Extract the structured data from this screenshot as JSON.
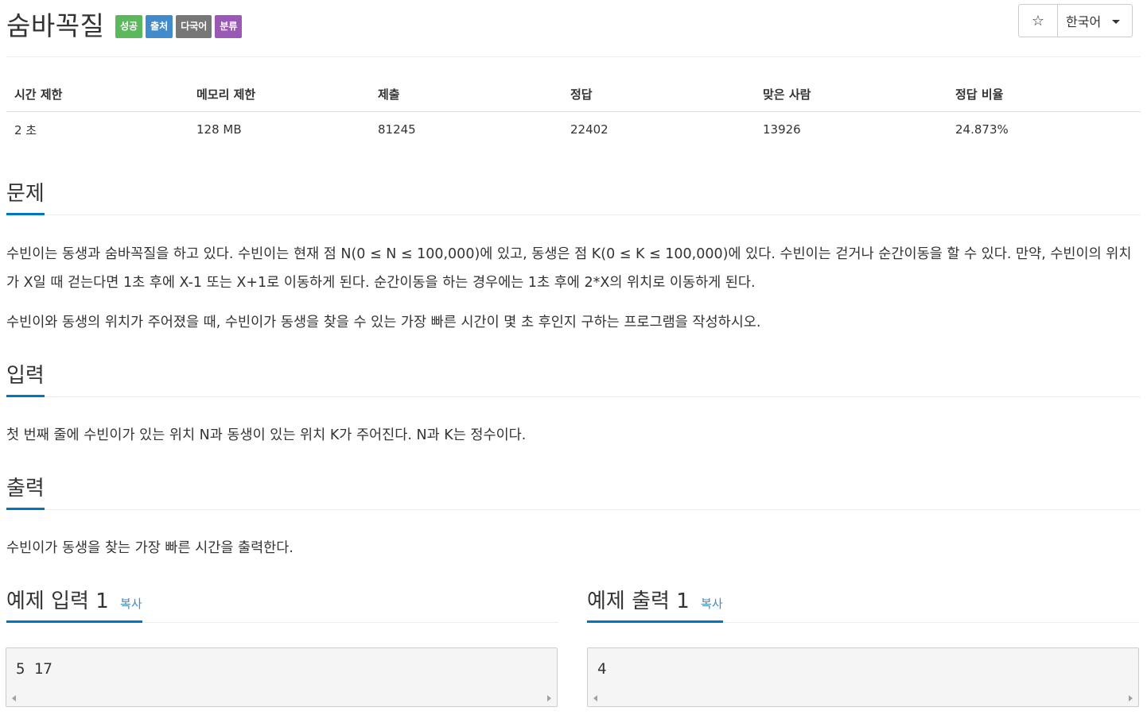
{
  "problem": {
    "title": "숨바꼭질",
    "badges": [
      "성공",
      "출처",
      "다국어",
      "분류"
    ]
  },
  "controls": {
    "star_glyph": "☆",
    "language": "한국어"
  },
  "info_table": {
    "headers": [
      "시간 제한",
      "메모리 제한",
      "제출",
      "정답",
      "맞은 사람",
      "정답 비율"
    ],
    "values": [
      "2 초",
      "128 MB",
      "81245",
      "22402",
      "13926",
      "24.873%"
    ]
  },
  "sections": {
    "description": {
      "title": "문제",
      "paragraphs": [
        "수빈이는 동생과 숨바꼭질을 하고 있다. 수빈이는 현재 점 N(0 ≤ N ≤ 100,000)에 있고, 동생은 점 K(0 ≤ K ≤ 100,000)에 있다. 수빈이는 걷거나 순간이동을 할 수 있다. 만약, 수빈이의 위치가 X일 때 걷는다면 1초 후에 X-1 또는 X+1로 이동하게 된다. 순간이동을 하는 경우에는 1초 후에 2*X의 위치로 이동하게 된다.",
        "수빈이와 동생의 위치가 주어졌을 때, 수빈이가 동생을 찾을 수 있는 가장 빠른 시간이 몇 초 후인지 구하는 프로그램을 작성하시오."
      ]
    },
    "input": {
      "title": "입력",
      "text": "첫 번째 줄에 수빈이가 있는 위치 N과 동생이 있는 위치 K가 주어진다. N과 K는 정수이다."
    },
    "output": {
      "title": "출력",
      "text": "수빈이가 동생을 찾는 가장 빠른 시간을 출력한다."
    }
  },
  "samples": {
    "input": {
      "title": "예제 입력 1",
      "copy_label": "복사",
      "content": "5 17"
    },
    "output": {
      "title": "예제 출력 1",
      "copy_label": "복사",
      "content": "4"
    }
  }
}
